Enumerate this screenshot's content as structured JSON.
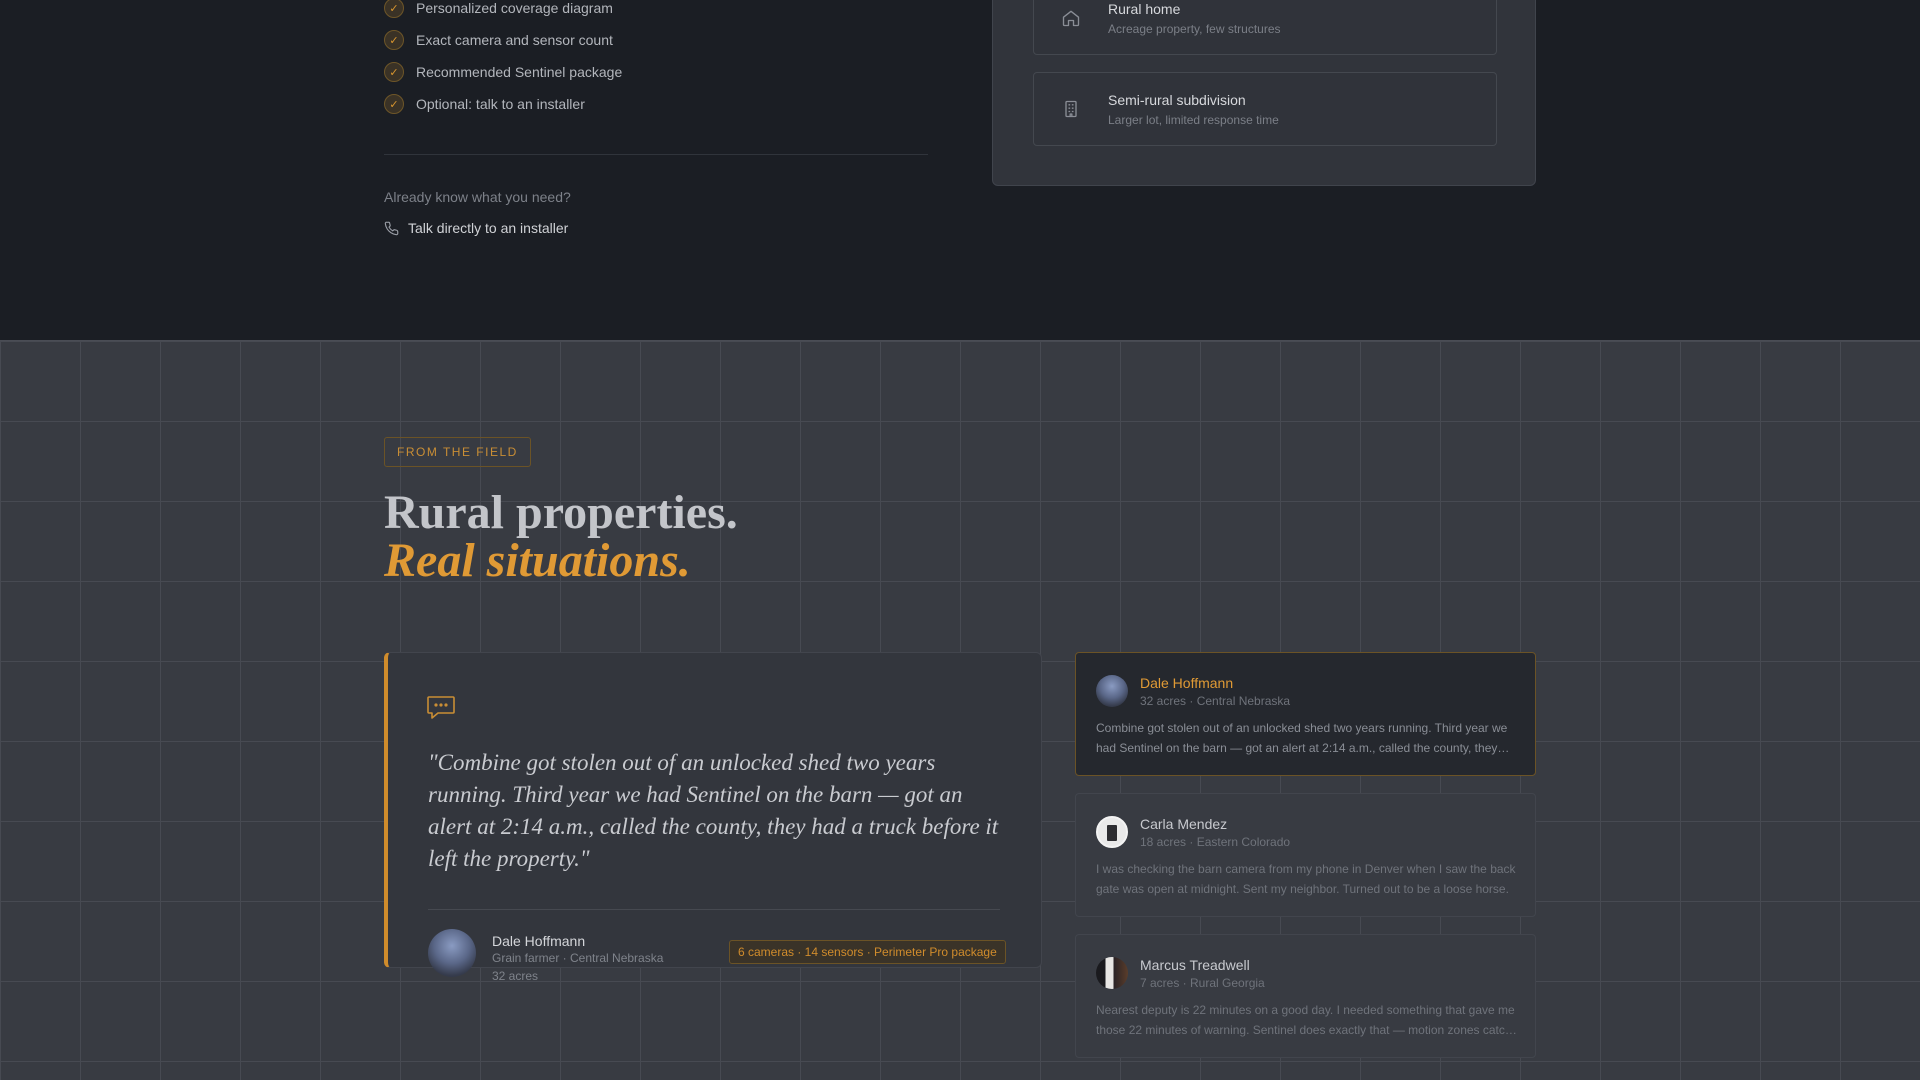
{
  "checklist": [
    "Personalized coverage diagram",
    "Exact camera and sensor count",
    "Recommended Sentinel package",
    "Optional: talk to an installer"
  ],
  "already_know": "Already know what you need?",
  "talk_link": {
    "label": "Talk directly to an installer",
    "icon": "phone-icon"
  },
  "property_options": [
    {
      "title": "Rural home",
      "subtitle": "Acreage property, few structures",
      "icon": "home-icon"
    },
    {
      "title": "Semi-rural subdivision",
      "subtitle": "Larger lot, limited response time",
      "icon": "building-icon"
    }
  ],
  "eyebrow": "FROM THE FIELD",
  "headline": {
    "line1": "Rural properties.",
    "line2": "Real situations."
  },
  "featured": {
    "quote": "\"Combine got stolen out of an unlocked shed two years running. Third year we had Sentinel on the barn — got an alert at 2:14 a.m., called the county, they had a truck before it left the property.\"",
    "name": "Dale Hoffmann",
    "role": "Grain farmer · Central Nebraska",
    "acres": "32 acres",
    "badge": "6 cameras · 14 sensors · Perimeter Pro package"
  },
  "testimonials": [
    {
      "name": "Dale Hoffmann",
      "meta": "32 acres · Central Nebraska",
      "excerpt": "Combine got stolen out of an unlocked shed two years running. Third year we had Sentinel on the barn — got an alert at 2:14 a.m., called the county, they had a truck before it left the property.",
      "active": true
    },
    {
      "name": "Carla Mendez",
      "meta": "18 acres · Eastern Colorado",
      "excerpt": "I was checking the barn camera from my phone in Denver when I saw the back gate was open at midnight. Sent my neighbor. Turned out to be a loose horse.",
      "active": false
    },
    {
      "name": "Marcus Treadwell",
      "meta": "7 acres · Rural Georgia",
      "excerpt": "Nearest deputy is 22 minutes on a good day. I needed something that gave me those 22 minutes of warning. Sentinel does exactly that — motion zones catch everything.",
      "active": false
    }
  ],
  "colors": {
    "accent": "#d08c2c",
    "background_top": "#1b1e24",
    "background_bottom": "#383b42"
  }
}
